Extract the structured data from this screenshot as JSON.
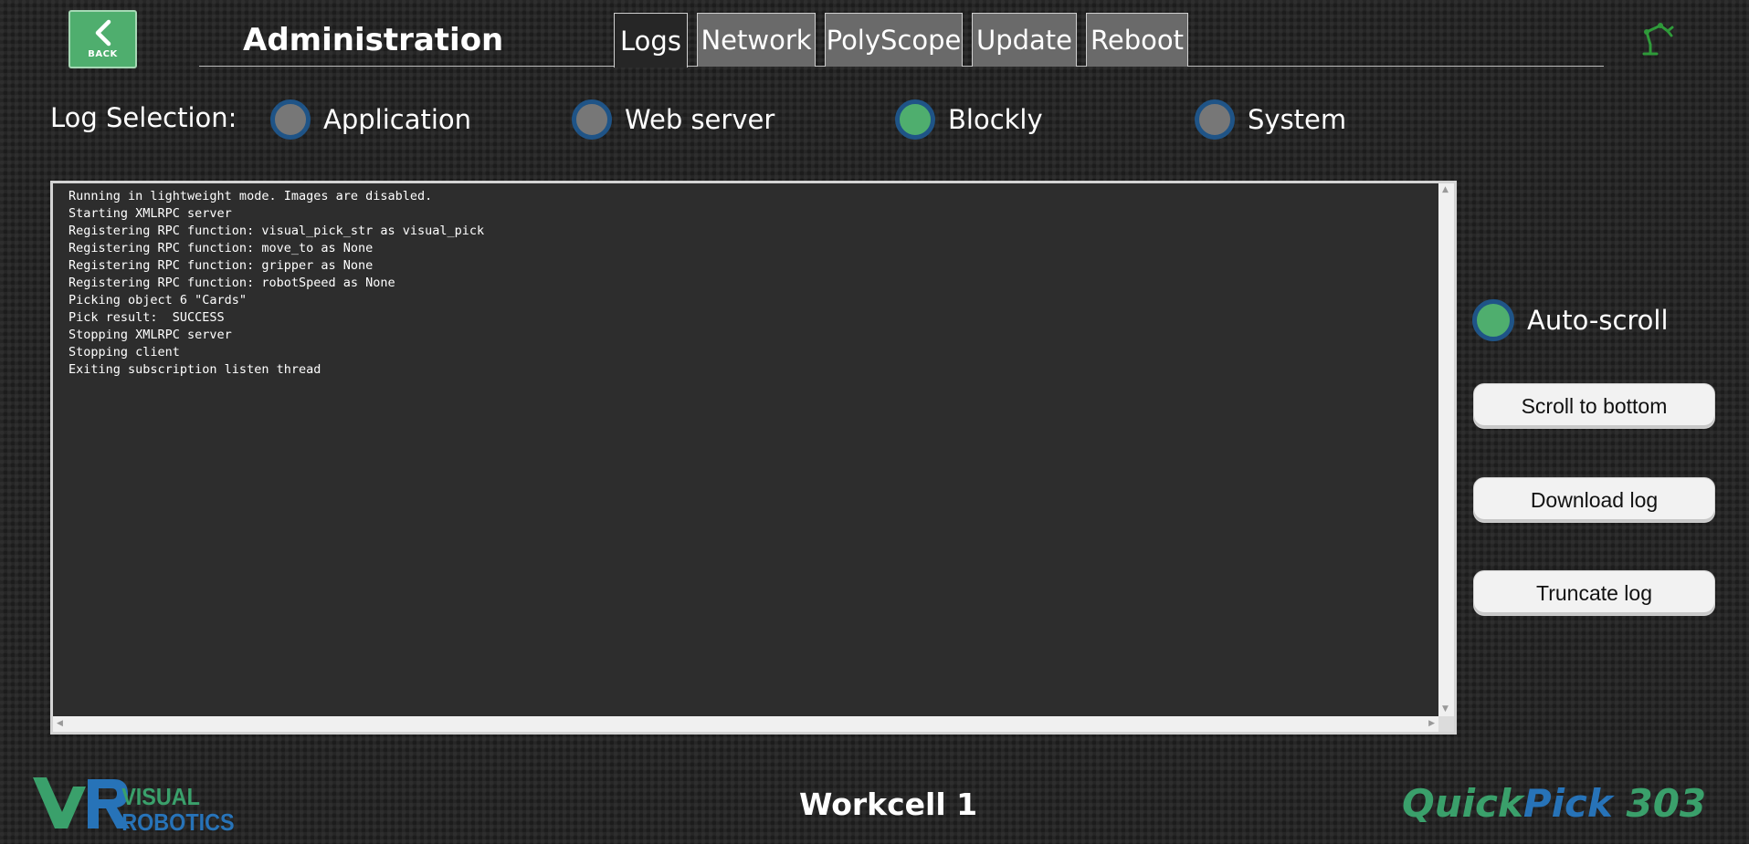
{
  "header": {
    "back_label": "BACK",
    "title": "Administration",
    "tabs": [
      {
        "label": "Logs",
        "active": true
      },
      {
        "label": "Network",
        "active": false
      },
      {
        "label": "PolyScope",
        "active": false
      },
      {
        "label": "Update",
        "active": false
      },
      {
        "label": "Reboot",
        "active": false
      }
    ],
    "robot_icon": "robot-arm-icon"
  },
  "log_selection": {
    "label": "Log Selection:",
    "options": [
      {
        "label": "Application",
        "selected": false
      },
      {
        "label": "Web server",
        "selected": false
      },
      {
        "label": "Blockly",
        "selected": true
      },
      {
        "label": "System",
        "selected": false
      }
    ]
  },
  "log": {
    "lines": [
      "Running in lightweight mode. Images are disabled.",
      "Starting XMLRPC server",
      "Registering RPC function: visual_pick_str as visual_pick",
      "Registering RPC function: move_to as None",
      "Registering RPC function: gripper as None",
      "Registering RPC function: robotSpeed as None",
      "Picking object 6 \"Cards\"",
      "Pick result:  SUCCESS",
      "Stopping XMLRPC server",
      "Stopping client",
      "Exiting subscription listen thread"
    ]
  },
  "controls": {
    "autoscroll_label": "Auto-scroll",
    "autoscroll_on": true,
    "scroll_to_bottom": "Scroll to bottom",
    "download_log": "Download log",
    "truncate_log": "Truncate log"
  },
  "footer": {
    "brand_top": "VISUAL",
    "brand_bottom": "ROBOTICS",
    "workcell": "Workcell 1",
    "product_part1": "Quick",
    "product_part2": "Pick",
    "product_part3": " 303"
  },
  "colors": {
    "accent_green": "#4fae6e",
    "radio_ring": "#1f5487",
    "product_green": "#3aa06b",
    "product_blue": "#2773b8"
  }
}
